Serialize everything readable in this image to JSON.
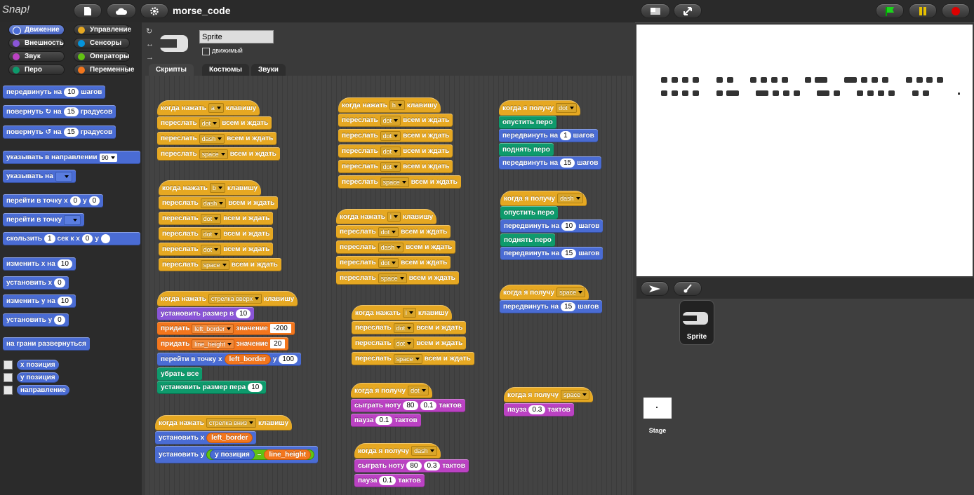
{
  "topbar": {
    "logo": "Snap!",
    "project_name": "morse_code"
  },
  "categories": [
    {
      "label": "Движение",
      "color": "#4a6cd4",
      "selected": true
    },
    {
      "label": "Управление",
      "color": "#e6a822"
    },
    {
      "label": "Внешность",
      "color": "#8a55d7"
    },
    {
      "label": "Сенсоры",
      "color": "#0494dc"
    },
    {
      "label": "Звук",
      "color": "#bb42c3"
    },
    {
      "label": "Операторы",
      "color": "#62c213"
    },
    {
      "label": "Перо",
      "color": "#0e9a6c"
    },
    {
      "label": "Переменные",
      "color": "#f3761d"
    }
  ],
  "palette": {
    "move": "передвинуть на",
    "move_steps": "10",
    "steps": "шагов",
    "turn_cw": "повернуть",
    "turn_on": "на",
    "turn_deg": "15",
    "degrees": "градусов",
    "turn_ccw": "повернуть",
    "point_dir": "указывать в направлении",
    "point_dir_val": "90",
    "point_to": "указывать на",
    "goto_xy": "перейти в точку х",
    "goto_x": "0",
    "goto_y_label": "у",
    "goto_y": "0",
    "goto": "перейти в точку",
    "glide": "скользить",
    "glide_secs": "1",
    "glide_secs_label": "сек к х",
    "glide_x": "0",
    "glide_y_label": "у",
    "change_x": "изменить х на",
    "change_x_val": "10",
    "set_x": "установить х",
    "set_x_val": "0",
    "change_y": "изменить у на",
    "change_y_val": "10",
    "set_y": "установить у",
    "set_y_val": "0",
    "bounce": "на грани развернуться",
    "x_pos": "х позиция",
    "y_pos": "у позиция",
    "direction": "направление"
  },
  "sprite": {
    "name": "Sprite",
    "draggable_label": "движимый"
  },
  "tabs": [
    "Скрипты",
    "Костюмы",
    "Звуки"
  ],
  "labels": {
    "when_key": "когда нажать",
    "key_suffix": "клавишу",
    "broadcast": "переслать",
    "all_wait": "всем и ждать",
    "when_receive": "когда я получу",
    "pen_down": "опустить перо",
    "pen_up": "поднять перо",
    "move": "передвинуть на",
    "steps": "шагов",
    "set_size": "установить размер в",
    "set_var": "придать",
    "value": "значение",
    "goto_x": "перейти в точку х",
    "y": "у",
    "clear": "убрать все",
    "pen_size": "установить размер пера",
    "set_x": "установить х",
    "set_y": "установить у",
    "y_pos": "у позиция",
    "minus": "–",
    "play_note": "сыграть ноту",
    "beats": "тактов",
    "rest": "пауза"
  },
  "keys": {
    "a": "a",
    "b": "b",
    "h": "h",
    "i": "i",
    "j": "i",
    "up": "стрелка вверх",
    "down": "стрелка вниз"
  },
  "msgs": {
    "dot": "dot",
    "dash": "dash",
    "space": "space"
  },
  "vars": {
    "left_border": "left_border",
    "line_height": "line_height"
  },
  "vals": {
    "n1": "1",
    "n15": "15",
    "n10": "10",
    "n200": "-200",
    "n20": "20",
    "n100": "100",
    "n80": "80",
    "n01": "0.1",
    "n03": "0.3"
  },
  "corral": {
    "sprite_label": "Sprite",
    "stage_label": "Stage"
  }
}
